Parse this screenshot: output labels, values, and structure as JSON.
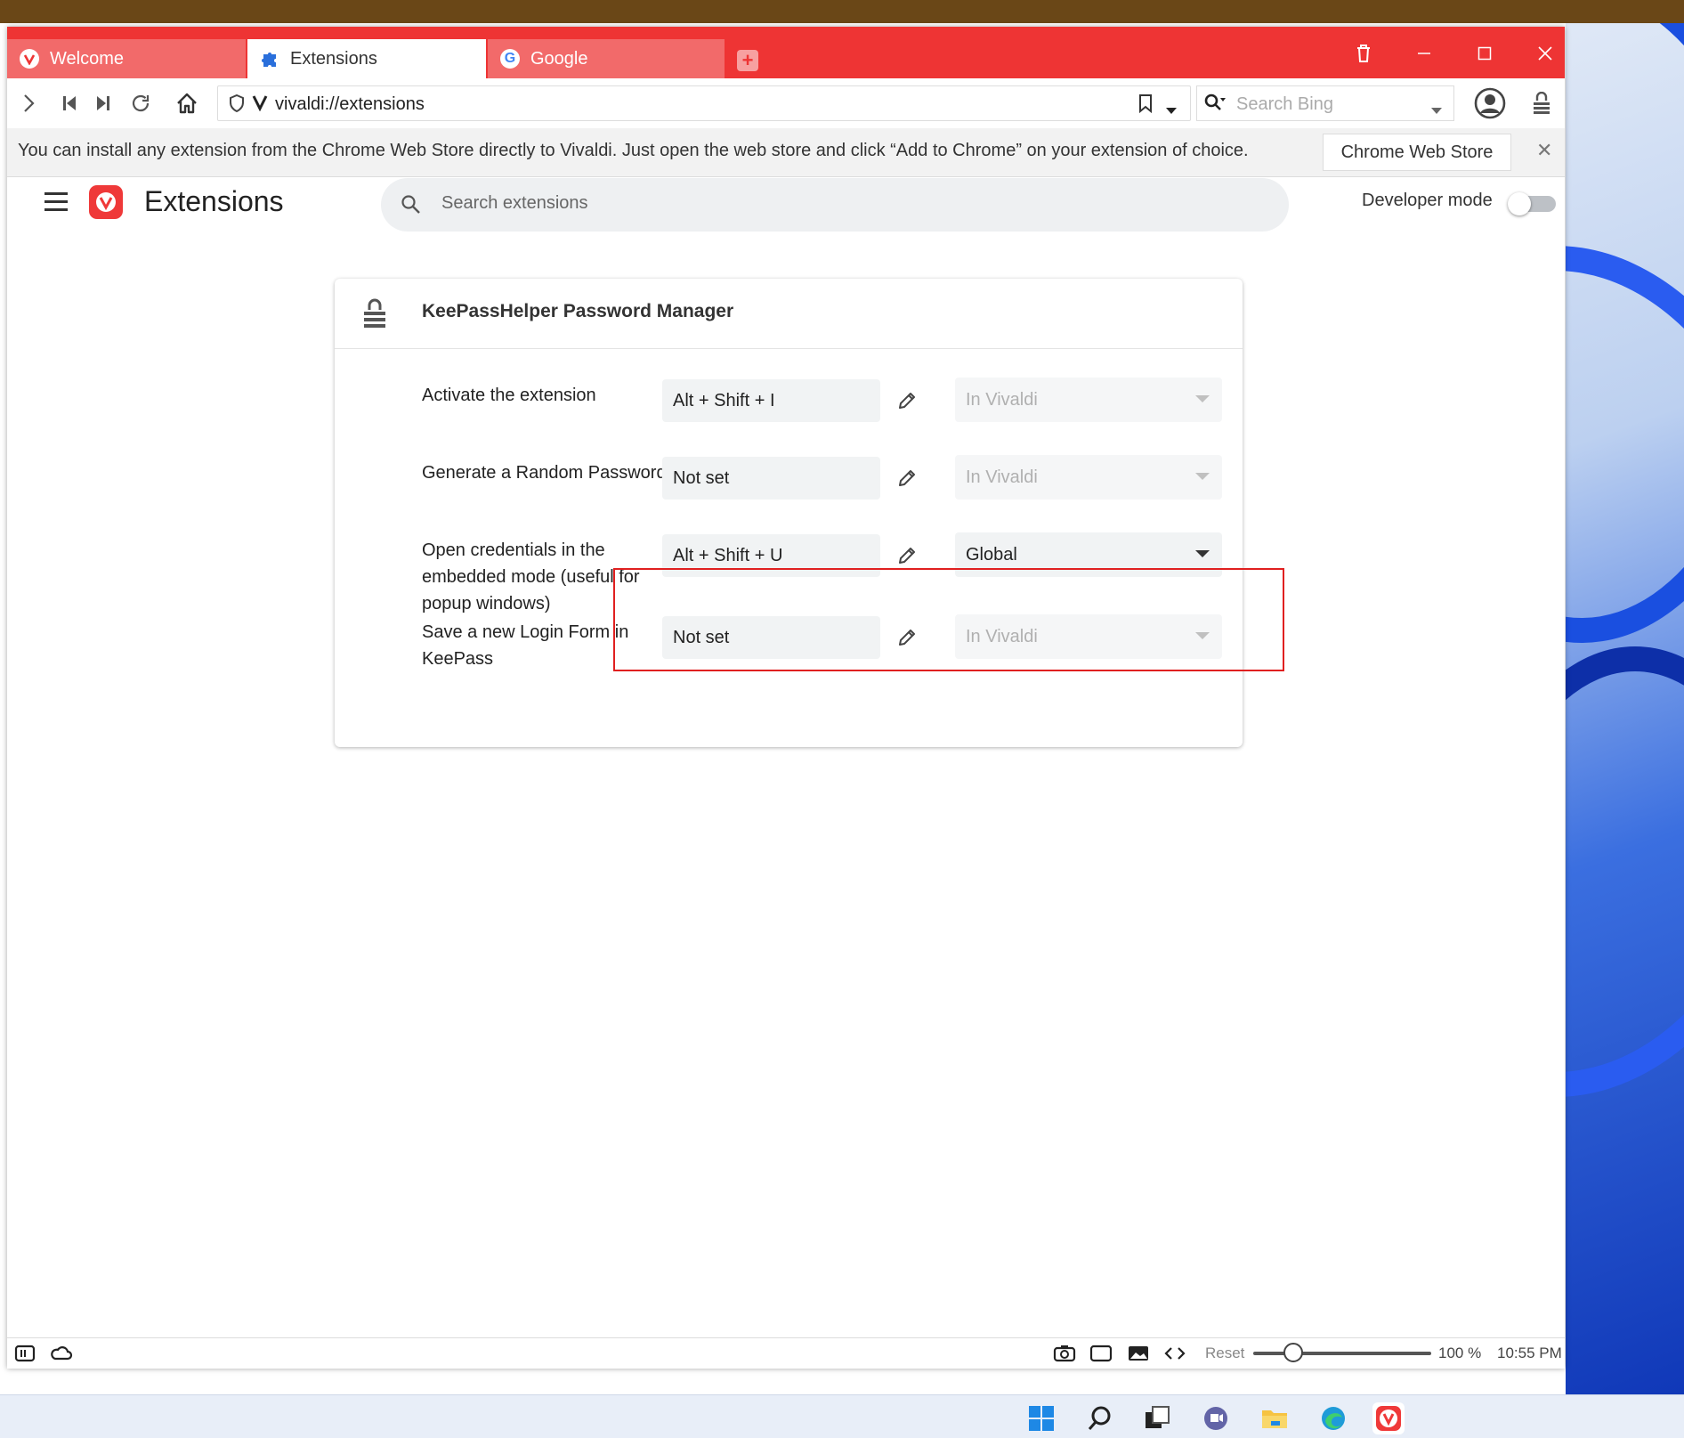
{
  "tabs": [
    {
      "label": "Welcome",
      "state": "inactive",
      "icon": "vivaldi-icon"
    },
    {
      "label": "Extensions",
      "state": "active",
      "icon": "puzzle-icon"
    },
    {
      "label": "Google",
      "state": "inactive",
      "icon": "google-icon"
    }
  ],
  "address": {
    "url": "vivaldi://extensions",
    "search_placeholder": "Search Bing"
  },
  "infobar": {
    "message": "You can install any extension from the Chrome Web Store directly to Vivaldi. Just open the web store and click “Add to Chrome” on your extension of choice.",
    "button_label": "Chrome Web Store",
    "close_glyph": "✕"
  },
  "header": {
    "title": "Extensions",
    "search_placeholder": "Search extensions",
    "developer_mode_label": "Developer mode",
    "developer_mode_on": false
  },
  "extension": {
    "name": "KeePassHelper Password Manager",
    "shortcuts": [
      {
        "label": "Activate the extension",
        "shortcut": "Alt + Shift + I",
        "scope": "In Vivaldi",
        "scope_enabled": false
      },
      {
        "label": "Generate a Random Password",
        "shortcut": "Not set",
        "scope": "In Vivaldi",
        "scope_enabled": false
      },
      {
        "label": "Open credentials in the embedded mode (useful for popup windows)",
        "shortcut": "Alt + Shift + U",
        "scope": "Global",
        "scope_enabled": true
      },
      {
        "label": "Save a new Login Form in KeePass",
        "shortcut": "Not set",
        "scope": "In Vivaldi",
        "scope_enabled": false
      }
    ]
  },
  "statusbar": {
    "reset_label": "Reset",
    "zoom": "100 %",
    "clock": "10:55 PM"
  },
  "colors": {
    "accent": "#ee3434",
    "highlight": "#e02020"
  }
}
